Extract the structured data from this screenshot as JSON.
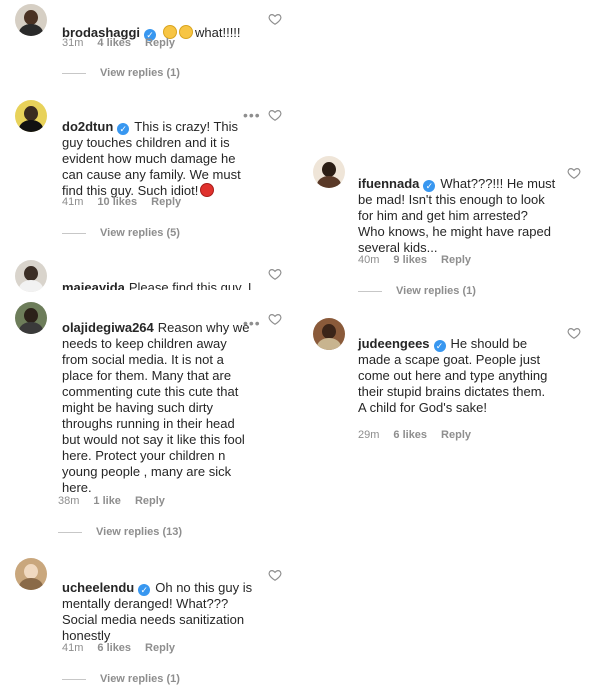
{
  "comments": [
    {
      "username": "brodashaggi",
      "verified": true,
      "text": "",
      "emoji_suffix": "flushed flushed",
      "text_after": "what!!!!!",
      "time": "31m",
      "likes": "4 likes",
      "reply_label": "Reply",
      "view_replies": "View replies (1)",
      "avatar_color": "#2a2a2a",
      "avatar_accent": "#c94f3b"
    },
    {
      "username": "do2dtun",
      "verified": true,
      "text": "This is crazy! This guy touches children and it is evident how much damage he can cause any family. We must find this guy. Such idiot!",
      "time": "41m",
      "likes": "10 likes",
      "reply_label": "Reply",
      "view_replies": "View replies (5)",
      "avatar_color": "#e8d25a",
      "avatar_accent": "#3a2b20"
    },
    {
      "username": "majeayida",
      "verified": false,
      "text": "Please find this guy, I wanna ask him something..",
      "avatar_color": "#d9d4cc",
      "avatar_accent": "#3b2e25"
    },
    {
      "username": "olajidegiwa264",
      "verified": false,
      "text": "Reason why we needs to keep children away from social media. It is not a place for them. Many that are commenting cute this cute that might be having such dirty throughs running in their head but would not say it like this fool here. Protect your children n young people , many are sick here.",
      "time": "38m",
      "likes": "1 like",
      "reply_label": "Reply",
      "view_replies": "View replies (13)",
      "avatar_color": "#6d7d5a",
      "avatar_accent": "#2b2119"
    },
    {
      "username": "ucheelendu",
      "verified": true,
      "text": "Oh no this guy is mentally deranged! What???\nSocial media needs sanitization honestly",
      "time": "41m",
      "likes": "6 likes",
      "reply_label": "Reply",
      "view_replies": "View replies (1)",
      "avatar_color": "#c9a77d",
      "avatar_accent": "#f0d9c0"
    },
    {
      "username": "ifuennada",
      "verified": true,
      "text": "What???!!! He must be mad! Isn't this enough to look for him and get him arrested? Who knows, he might have raped several kids...",
      "time": "40m",
      "likes": "9 likes",
      "reply_label": "Reply",
      "view_replies": "View replies (1)",
      "avatar_color": "#efe5d8",
      "avatar_accent": "#2b1d14"
    },
    {
      "username": "judeengees",
      "verified": true,
      "text": "He should be made a scape goat. People just come out here and type anything their stupid brains dictates them. A child for God's sake!",
      "time": "29m",
      "likes": "6 likes",
      "reply_label": "Reply",
      "avatar_color": "#8a5a3a",
      "avatar_accent": "#3b2418"
    }
  ],
  "icons": {
    "heart": "heart-outline-icon",
    "more": "more-options-icon",
    "verified": "verified-badge-icon"
  },
  "colors": {
    "text": "#262626",
    "muted": "#8e8e8e",
    "verified": "#3897f0"
  }
}
